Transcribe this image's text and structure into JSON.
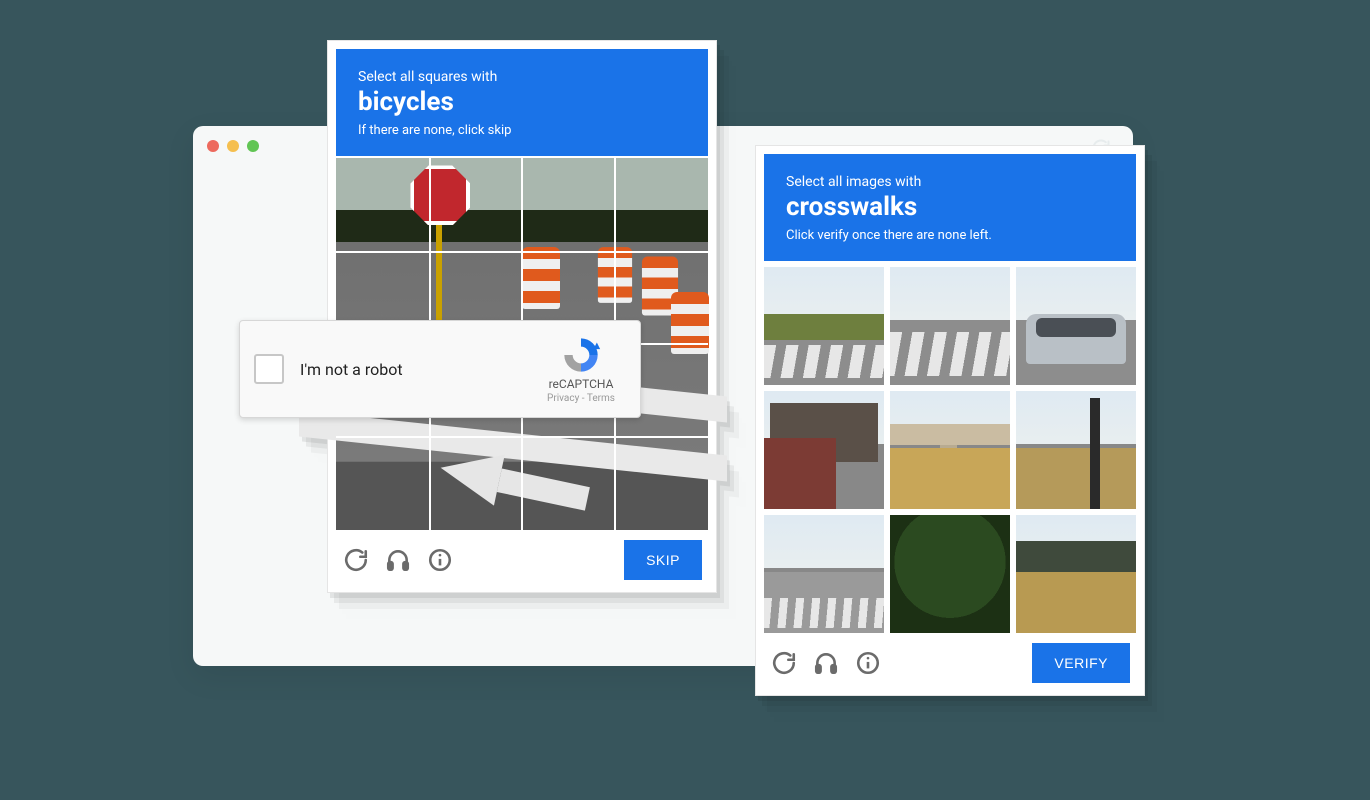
{
  "captcha_left": {
    "line1": "Select all squares with",
    "target": "bicycles",
    "line2": "If there are none, click skip",
    "action": "SKIP",
    "grid": {
      "rows": 4,
      "cols": 4
    }
  },
  "captcha_right": {
    "line1": "Select all images with",
    "target": "crosswalks",
    "line2": "Click verify once there are none left.",
    "action": "VERIFY",
    "grid": {
      "rows": 3,
      "cols": 3
    }
  },
  "recaptcha": {
    "label": "I'm not a robot",
    "brand": "reCAPTCHA",
    "legal": "Privacy - Terms"
  },
  "icons": {
    "reload": "reload-icon",
    "audio": "headphones-icon",
    "info": "info-icon"
  },
  "colors": {
    "accent": "#1a73e8",
    "background": "#37555c"
  }
}
